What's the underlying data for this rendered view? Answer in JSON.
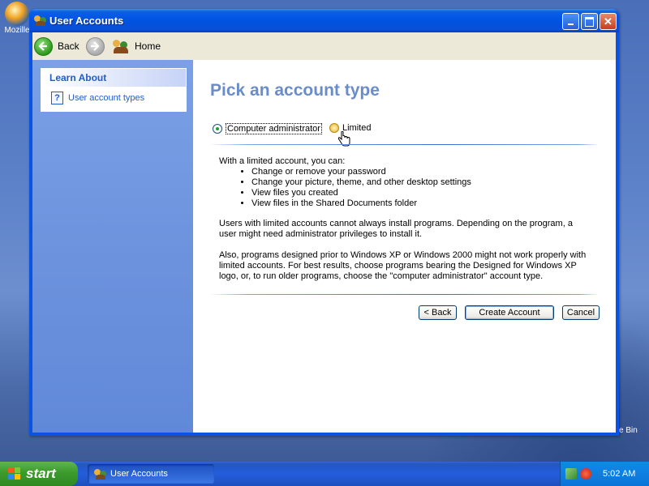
{
  "desktop": {
    "icon_label": "Mozille",
    "recycle_label": "e Bin"
  },
  "window": {
    "title": "User Accounts",
    "buttons": {
      "minimize": "_",
      "maximize": "□",
      "close": "✕"
    }
  },
  "navbar": {
    "back_label": "Back",
    "home_label": "Home"
  },
  "sidebar": {
    "learn_header": "Learn About",
    "learn_item": "User account types"
  },
  "main": {
    "title": "Pick an account type",
    "radio_admin": "Computer administrator",
    "radio_limited": "Limited",
    "selected": "Computer administrator",
    "intro": "With a limited account, you can:",
    "bullets": [
      "Change or remove your password",
      "Change your picture, theme, and other desktop settings",
      "View files you created",
      "View files in the Shared Documents folder"
    ],
    "para1": "Users with limited accounts cannot always install programs. Depending on the program, a user might need administrator privileges to install it.",
    "para2": "Also, programs designed prior to Windows XP or Windows 2000 might not work properly with limited accounts. For best results, choose programs bearing the Designed for Windows XP logo, or, to run older programs, choose the \"computer administrator\" account type.",
    "back_button": "< Back",
    "create_button": "Create Account",
    "cancel_button": "Cancel"
  },
  "taskbar": {
    "start_label": "start",
    "task_label": "User Accounts",
    "clock": "5:02 AM"
  },
  "colors": {
    "title_blue": "#0053e0",
    "heading": "#6a8cc8",
    "link": "#215dc6",
    "start_green": "#3c9a2c"
  }
}
